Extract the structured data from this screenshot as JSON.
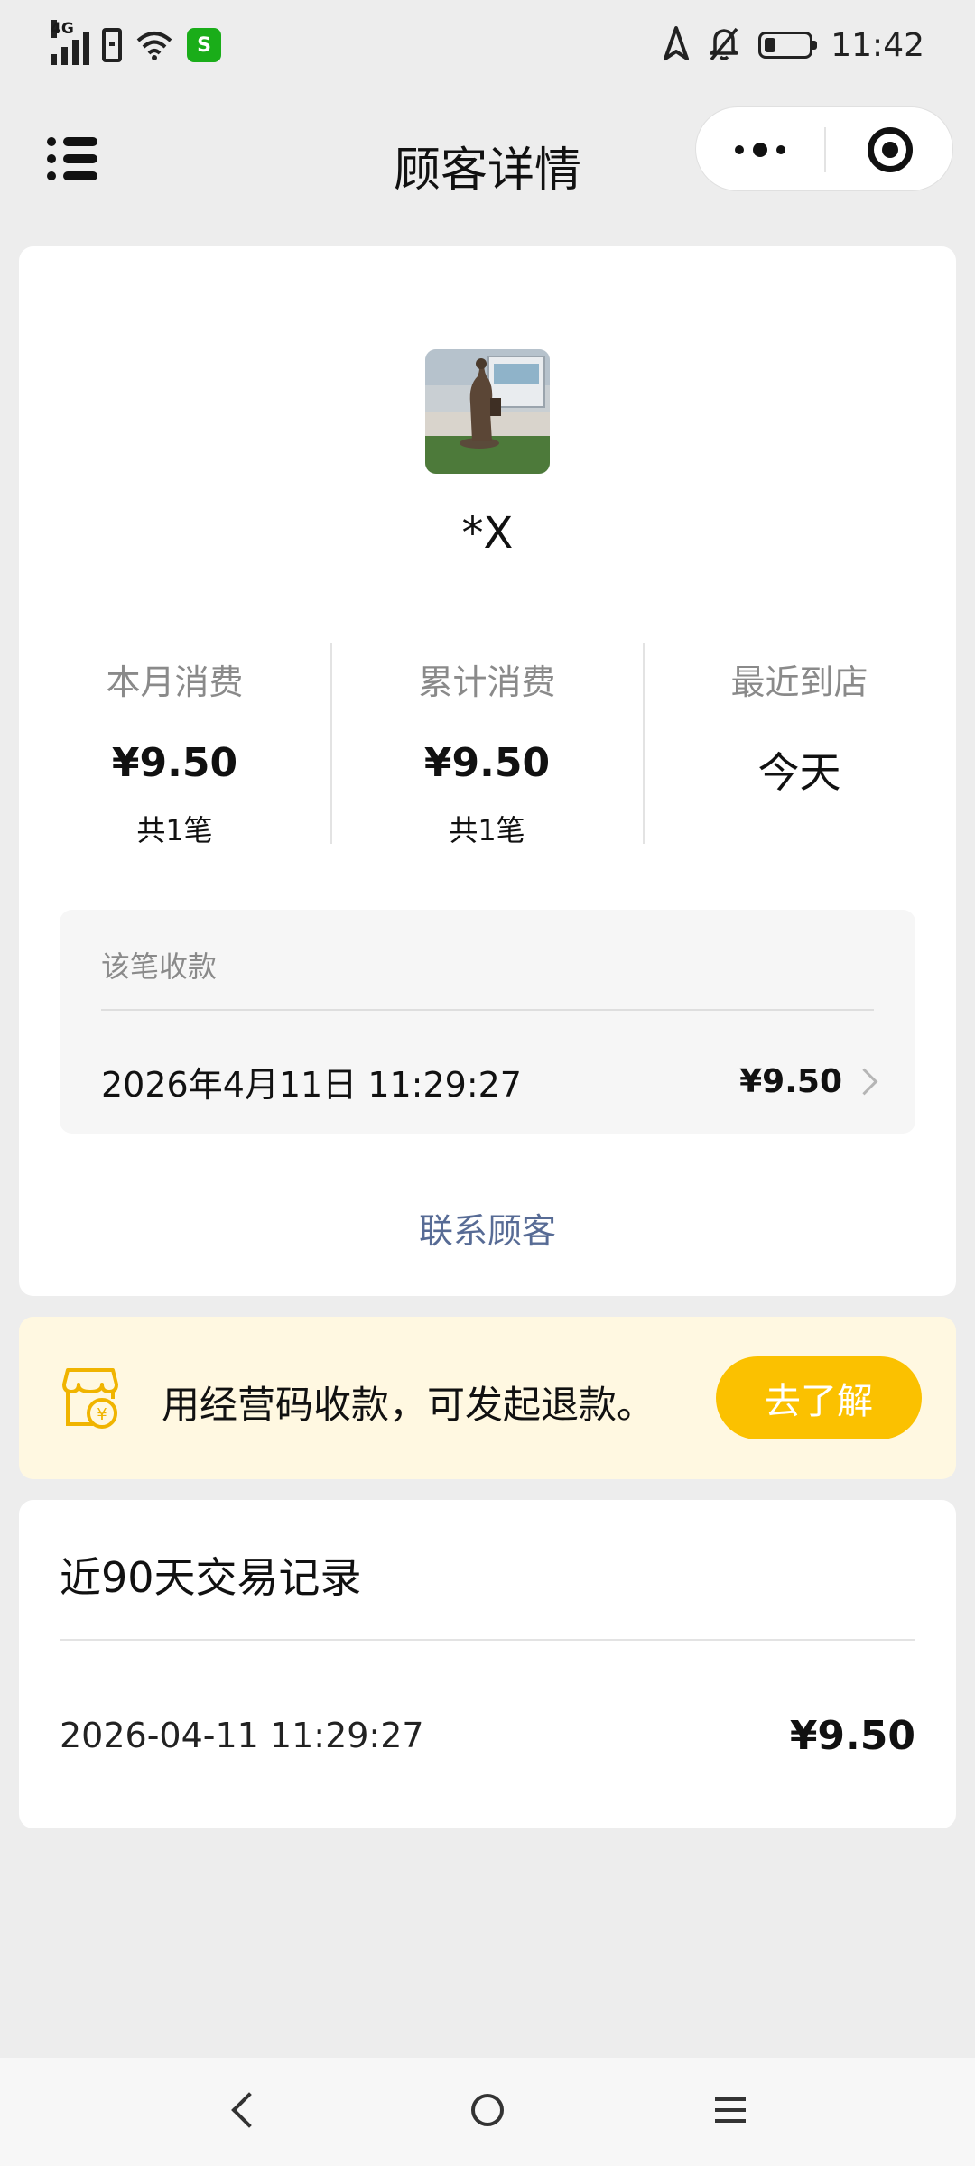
{
  "status_bar": {
    "network": "4G",
    "app_badge": "S",
    "time": "11:42",
    "battery_level": 0.25
  },
  "title_bar": {
    "title": "顾客详情",
    "menu_icon": "list-icon",
    "more_icon": "more-dots-icon",
    "close_icon": "target-icon"
  },
  "customer": {
    "name": "*X"
  },
  "stats": [
    {
      "label": "本月消费",
      "value": "¥9.50",
      "count": "共1笔"
    },
    {
      "label": "累计消费",
      "value": "¥9.50",
      "count": "共1笔"
    },
    {
      "label": "最近到店",
      "value": "今天"
    }
  ],
  "payment": {
    "heading": "该笔收款",
    "date": "2026年4月11日 11:29:27",
    "amount": "¥9.50"
  },
  "contact_link": "联系顾客",
  "banner": {
    "text": "用经营码收款，可发起退款。",
    "button": "去了解",
    "icon": "shop-icon"
  },
  "records": {
    "title": "近90天交易记录",
    "items": [
      {
        "date": "2026-04-11 11:29:27",
        "amount": "¥9.50"
      }
    ]
  },
  "nav_bar": {
    "back_icon": "back-icon",
    "home_icon": "home-icon",
    "menu_icon": "menu-icon"
  },
  "colors": {
    "background": "#ededed",
    "link": "#576b95",
    "banner_bg": "#fff8e1",
    "accent": "#fbc100",
    "app_badge": "#1aad19"
  }
}
